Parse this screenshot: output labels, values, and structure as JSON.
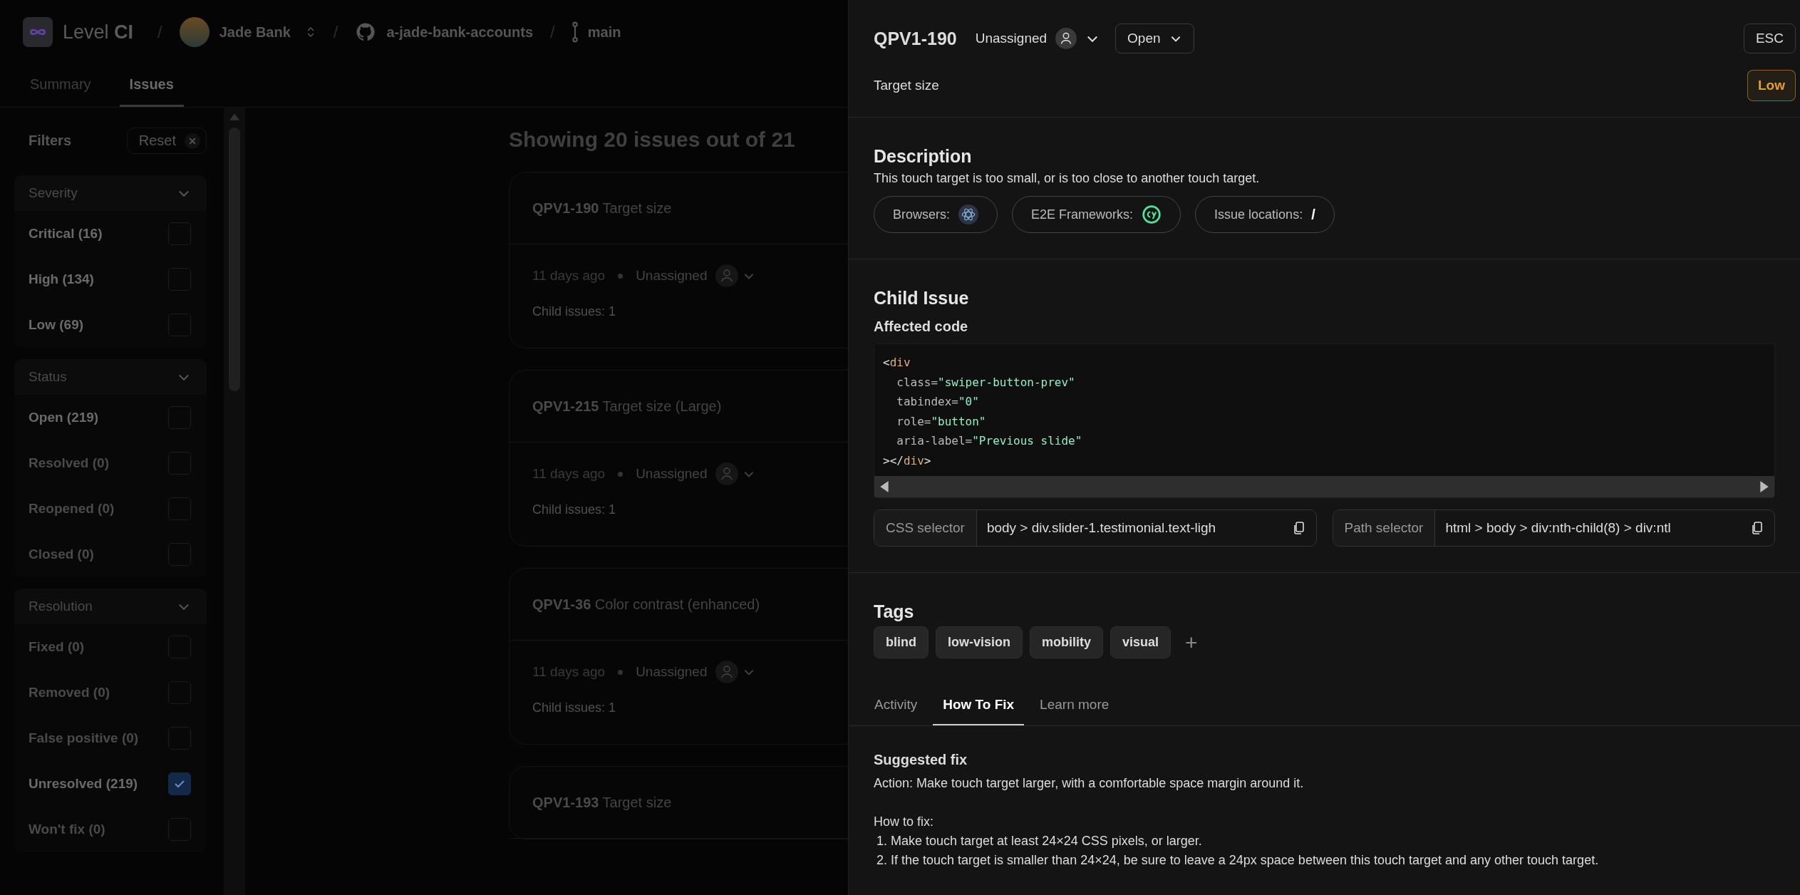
{
  "header": {
    "app_name": "Level **CI**",
    "breadcrumbs": [
      {
        "kind": "org",
        "separator": "/",
        "label": "Jade Bank"
      },
      {
        "kind": "repo",
        "separator": "/",
        "label": "a-jade-bank-accounts"
      },
      {
        "kind": "branch",
        "separator": "/",
        "label": "main"
      }
    ]
  },
  "tabs": [
    {
      "label": "Summary",
      "selected": false
    },
    {
      "label": "Issues",
      "selected": true
    }
  ],
  "filters": {
    "title": "Filters",
    "reset": "Reset",
    "groups": [
      {
        "title": "Severity",
        "expanded": true,
        "items": [
          {
            "label": "Critical (16)",
            "checked": false,
            "disabled": false
          },
          {
            "label": "High (134)",
            "checked": false,
            "disabled": false
          },
          {
            "label": "Low (69)",
            "checked": false,
            "disabled": false
          }
        ]
      },
      {
        "title": "Status",
        "expanded": true,
        "items": [
          {
            "label": "Open (219)",
            "checked": false,
            "disabled": false
          },
          {
            "label": "Resolved (0)",
            "checked": false,
            "disabled": true
          },
          {
            "label": "Reopened (0)",
            "checked": false,
            "disabled": true
          },
          {
            "label": "Closed (0)",
            "checked": false,
            "disabled": true
          }
        ]
      },
      {
        "title": "Resolution",
        "expanded": true,
        "items": [
          {
            "label": "Fixed (0)",
            "checked": false,
            "disabled": true
          },
          {
            "label": "Removed (0)",
            "checked": false,
            "disabled": true
          },
          {
            "label": "False positive (0)",
            "checked": false,
            "disabled": true
          },
          {
            "label": "Unresolved (219)",
            "checked": true,
            "disabled": false
          },
          {
            "label": "Won't fix (0)",
            "checked": false,
            "disabled": true
          }
        ]
      }
    ]
  },
  "issues": {
    "heading": "Showing 20 issues out of 21",
    "cards": [
      {
        "id": "QPV1-190",
        "title": "Target size",
        "time": "11 days ago",
        "assignee": "Unassigned",
        "children": "Child issues: 1"
      },
      {
        "id": "QPV1-215",
        "title": "Target size (Large)",
        "time": "11 days ago",
        "assignee": "Unassigned",
        "children": "Child issues: 1"
      },
      {
        "id": "QPV1-36",
        "title": "Color contrast (enhanced)",
        "time": "11 days ago",
        "assignee": "Unassigned",
        "children": "Child issues: 1"
      },
      {
        "id": "QPV1-193",
        "title": "Target size"
      }
    ]
  },
  "panel": {
    "id": "QPV1-190",
    "assignee": "Unassigned",
    "status": "Open",
    "close": "ESC",
    "title": "Target size",
    "severity": {
      "label": "Low",
      "kind": "low"
    },
    "description": {
      "heading": "Description",
      "text": "This touch target is too small, or is too close to another touch target.",
      "pills": [
        {
          "kind": "browsers",
          "label": "Browsers:"
        },
        {
          "kind": "frameworks",
          "label": "E2E Frameworks:"
        },
        {
          "kind": "locations",
          "label": "Issue locations:",
          "value": "/"
        }
      ]
    },
    "child_issue": {
      "heading": "Child Issue",
      "code_label": "Affected code",
      "code": [
        [
          {
            "kind": "punct",
            "text": "<"
          },
          {
            "kind": "tag",
            "text": "div"
          }
        ],
        [
          {
            "kind": "attr",
            "text": "  class="
          },
          {
            "kind": "string",
            "text": "\"swiper-button-prev\""
          }
        ],
        [
          {
            "kind": "attr",
            "text": "  tabindex="
          },
          {
            "kind": "string",
            "text": "\"0\""
          }
        ],
        [
          {
            "kind": "attr",
            "text": "  role="
          },
          {
            "kind": "string",
            "text": "\"button\""
          }
        ],
        [
          {
            "kind": "attr",
            "text": "  aria-label="
          },
          {
            "kind": "string",
            "text": "\"Previous slide\""
          }
        ],
        [
          {
            "kind": "punct",
            "text": "></"
          },
          {
            "kind": "tag",
            "text": "div"
          },
          {
            "kind": "punct",
            "text": ">"
          }
        ]
      ],
      "selectors": [
        {
          "label": "CSS selector",
          "value": "body > div.slider-1.testimonial.text-ligh"
        },
        {
          "label": "Path selector",
          "value": "html > body > div:nth-child(8) > div:ntl"
        }
      ]
    },
    "tags": {
      "heading": "Tags",
      "items": [
        "blind",
        "low-vision",
        "mobility",
        "visual"
      ],
      "add": "+"
    },
    "tabs": [
      {
        "label": "Activity",
        "selected": false
      },
      {
        "label": "How To Fix",
        "selected": true
      },
      {
        "label": "Learn more",
        "selected": false
      }
    ],
    "fix": {
      "heading": "Suggested fix",
      "action": "Action: Make touch target larger, with a comfortable space margin around it.",
      "how_label": "How to fix:",
      "steps": [
        "1. Make touch target at least 24×24 CSS pixels, or larger.",
        "2. If the touch target is smaller than 24×24, be sure to leave a 24px space between this touch target and any other touch target."
      ]
    }
  }
}
